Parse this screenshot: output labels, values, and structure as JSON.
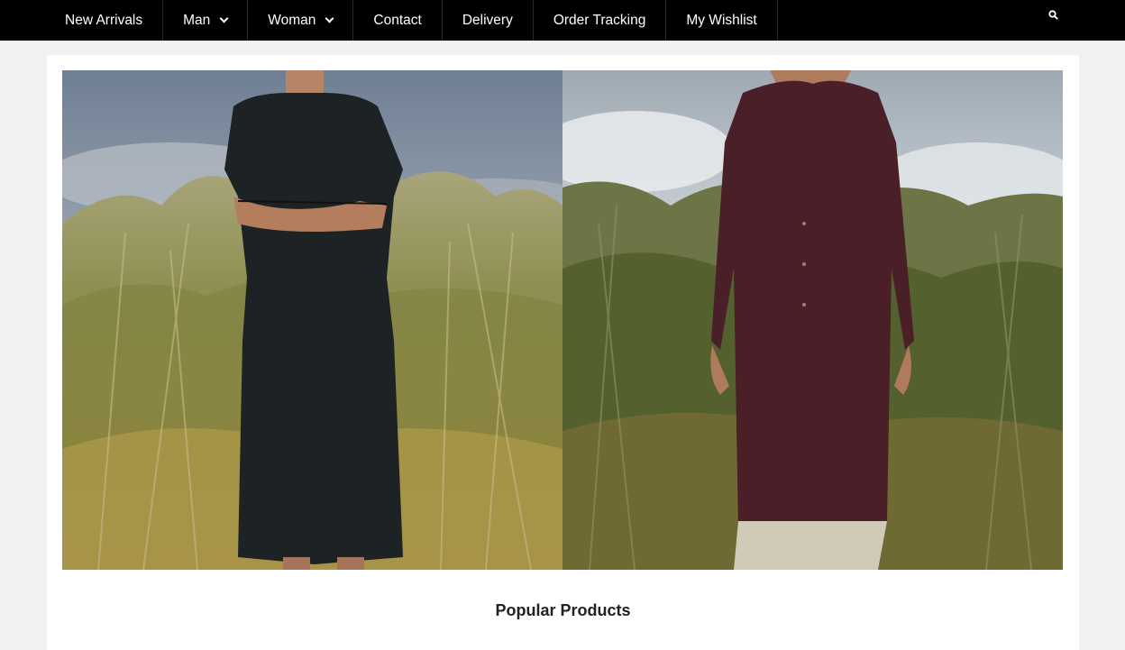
{
  "nav": {
    "items": [
      {
        "label": "New Arrivals",
        "dropdown": false
      },
      {
        "label": "Man",
        "dropdown": true
      },
      {
        "label": "Woman",
        "dropdown": true
      },
      {
        "label": "Contact",
        "dropdown": false
      },
      {
        "label": "Delivery",
        "dropdown": false
      },
      {
        "label": "Order Tracking",
        "dropdown": false
      },
      {
        "label": "My Wishlist",
        "dropdown": false
      }
    ],
    "search_icon": "search-icon"
  },
  "banner": {
    "left_image": "woman-in-black-dress-photo",
    "right_image": "woman-in-burgundy-shirt-dress-photo"
  },
  "section": {
    "title": "Popular Products"
  },
  "colors": {
    "nav_bg": "#000000",
    "page_bg": "#f1f1f1",
    "card_bg": "#ffffff"
  }
}
